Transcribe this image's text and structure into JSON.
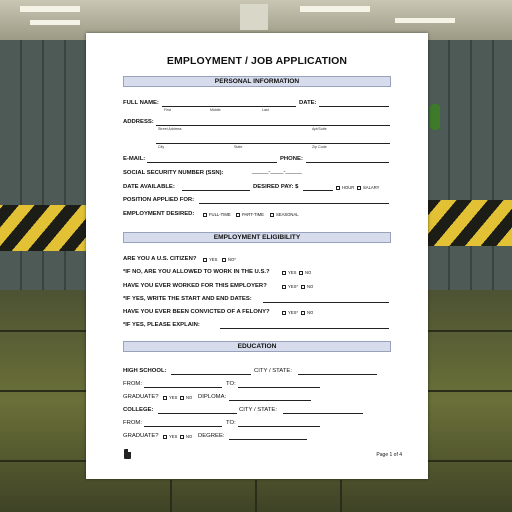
{
  "document": {
    "title": "EMPLOYMENT / JOB APPLICATION",
    "page_indicator": "Page 1 of 4"
  },
  "sections": {
    "personal": "PERSONAL INFORMATION",
    "eligibility": "EMPLOYMENT ELIGIBILITY",
    "education": "EDUCATION"
  },
  "personal": {
    "full_name": "FULL NAME:",
    "first": "First",
    "middle": "Middle",
    "last": "Last",
    "date": "DATE:",
    "address": "ADDRESS:",
    "street": "Street Address",
    "apt": "Apt/Suite",
    "city": "City",
    "state": "State",
    "zip": "Zip Code",
    "email": "E-MAIL:",
    "phone": "PHONE:",
    "ssn": "SOCIAL SECURITY NUMBER (SSN):",
    "ssn_mask": "_____-____-_____",
    "date_available": "DATE AVAILABLE:",
    "desired_pay": "DESIRED PAY: $",
    "hour": "HOUR",
    "salary": "SALARY",
    "position": "POSITION APPLIED FOR:",
    "employment_desired": "EMPLOYMENT DESIRED:",
    "full_time": "FULL-TIME",
    "part_time": "PART-TIME",
    "seasonal": "SEASONAL"
  },
  "eligibility": {
    "q1": "ARE YOU A U.S. CITIZEN?",
    "q2": "*IF NO, ARE YOU ALLOWED TO WORK IN THE U.S.?",
    "q3": "HAVE YOU EVER WORKED FOR THIS EMPLOYER?",
    "q4": "*IF YES, WRITE THE START AND END DATES:",
    "q5": "HAVE YOU EVER BEEN CONVICTED OF A FELONY?",
    "q6": "*IF YES, PLEASE EXPLAIN:",
    "yes": "YES",
    "no": "NO",
    "yes_star": "YES*",
    "no_star": "NO*"
  },
  "education": {
    "high_school": "HIGH SCHOOL:",
    "city_state": "CITY / STATE:",
    "from": "FROM:",
    "to": "TO:",
    "graduate": "GRADUATE?",
    "diploma": "DIPLOMA:",
    "college": "COLLEGE:",
    "degree": "DEGREE:",
    "yes": "YES",
    "no": "NO"
  }
}
